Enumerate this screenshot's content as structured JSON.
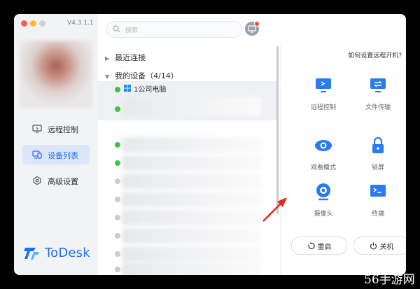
{
  "app": {
    "version": "V4.3.1.1",
    "logo_text": "ToDesk"
  },
  "sidebar": {
    "items": [
      {
        "label": "远程控制",
        "icon": "remote-control-icon",
        "active": false
      },
      {
        "label": "设备列表",
        "icon": "device-list-icon",
        "active": true
      },
      {
        "label": "高级设置",
        "icon": "settings-icon",
        "active": false
      }
    ]
  },
  "search": {
    "placeholder": "搜索"
  },
  "device_list": {
    "recent_label": "最近连接",
    "my_devices_label": "我的设备（4/14）",
    "first_device_name": "1公司电脑",
    "statuses": [
      "online",
      "online",
      "online",
      "online",
      "offline",
      "offline",
      "offline",
      "offline",
      "offline",
      "offline"
    ]
  },
  "panel": {
    "help_link": "如何设置远程开机?",
    "actions": [
      {
        "label": "远程控制",
        "icon": "remote-control-icon"
      },
      {
        "label": "文件传输",
        "icon": "file-transfer-icon"
      },
      {
        "label": "观看模式",
        "icon": "eye-icon"
      },
      {
        "label": "锁屏",
        "icon": "lock-icon"
      },
      {
        "label": "摄像头",
        "icon": "camera-icon"
      },
      {
        "label": "终端",
        "icon": "terminal-icon"
      }
    ],
    "restart_label": "重启",
    "shutdown_label": "关机"
  },
  "watermark": "56手游网",
  "colors": {
    "accent": "#2b6be8",
    "online": "#3cc43c",
    "offline": "#c8cacd",
    "annotation": "#e8261c"
  }
}
